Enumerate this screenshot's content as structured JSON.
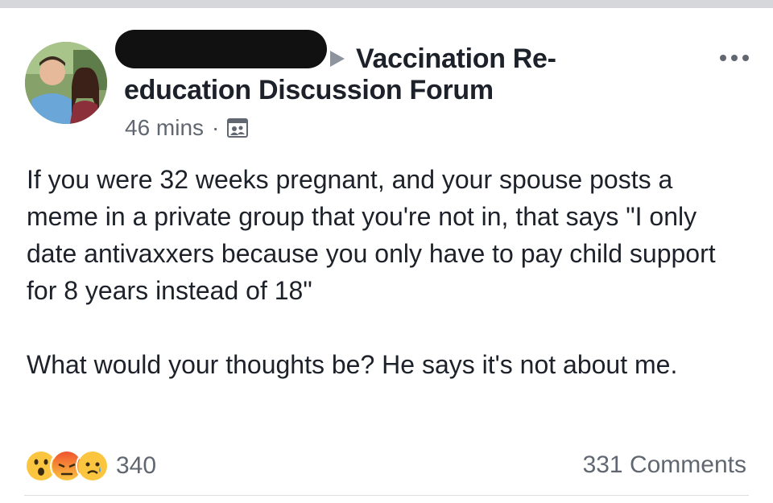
{
  "post": {
    "group_name_line1": "Vaccination Re-",
    "group_name_line2": "education Discussion Forum",
    "time": "46 mins",
    "separator": "·",
    "paragraphs": [
      "If you were 32 weeks pregnant, and your spouse posts a meme in a private group that you're not in, that says \"I only date antivaxxers because you only have to pay child support for 8 years instead of 18\"",
      "What would your thoughts be? He says it's not about me."
    ],
    "reaction_count": "340",
    "comments_label": "331 Comments"
  },
  "icons": {
    "arrow": "arrow-right-icon",
    "more": "more-options-icon",
    "privacy": "group-privacy-icon",
    "reactions": [
      "wow-reaction-icon",
      "angry-reaction-icon",
      "sad-reaction-icon"
    ]
  },
  "colors": {
    "text_primary": "#1d2129",
    "text_secondary": "#606770",
    "redaction": "#111111"
  }
}
